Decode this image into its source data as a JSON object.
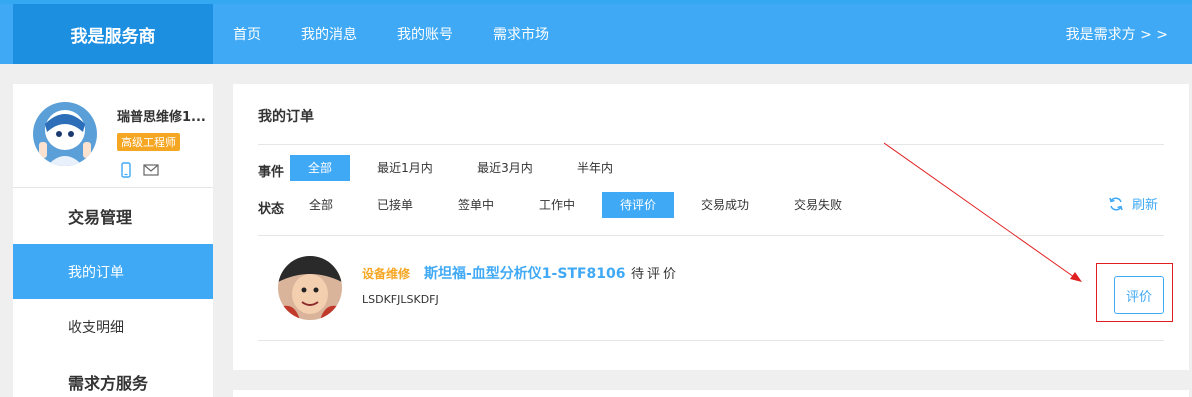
{
  "header": {
    "brand": "我是服务商",
    "nav": [
      "首页",
      "我的消息",
      "我的账号",
      "需求市场"
    ],
    "switch_role": "我是需求方 > >"
  },
  "profile": {
    "name": "瑞普思维修1...",
    "level": "高级工程师"
  },
  "sidebar": {
    "section1": "交易管理",
    "items": [
      "我的订单",
      "收支明细"
    ],
    "section2": "需求方服务"
  },
  "main": {
    "title": "我的订单",
    "time_label": "事件",
    "time_filters": [
      "全部",
      "最近1月内",
      "最近3月内",
      "半年内"
    ],
    "status_label": "状态",
    "status_filters": [
      "全部",
      "已接单",
      "签单中",
      "工作中",
      "待评价",
      "交易成功",
      "交易失败"
    ],
    "refresh": "刷新"
  },
  "order": {
    "tag": "设备维修",
    "title": "斯坦福-血型分析仪1-STF8106",
    "status": "待评价",
    "code": "LSDKFJLSKDFJ",
    "action": "评价"
  },
  "colors": {
    "accent": "#3fa9f5",
    "brand_bg": "#1d8fe1",
    "badge": "#f5a623",
    "annotation": "#e02020"
  }
}
